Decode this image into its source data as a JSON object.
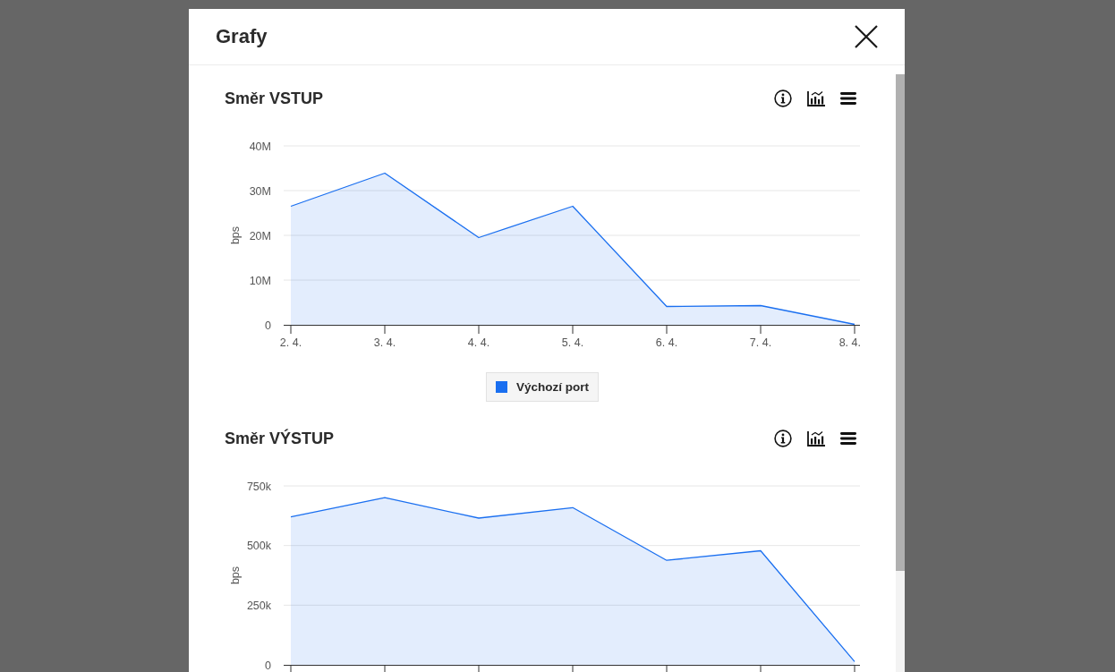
{
  "modal": {
    "title": "Grafy"
  },
  "charts": [
    {
      "title": "Směr VSTUP",
      "chart_data": {
        "type": "area",
        "grid": true,
        "ylabel": "bps",
        "categories": [
          "2. 4.",
          "3. 4.",
          "4. 4.",
          "5. 4.",
          "6. 4.",
          "7. 4.",
          "8. 4."
        ],
        "series": [
          {
            "name": "Výchozí port",
            "color": "#1a6ff0",
            "values": [
              26500000,
              33900000,
              19500000,
              26500000,
              4100000,
              4300000,
              100000
            ]
          }
        ],
        "ylim": [
          0,
          40000000
        ],
        "yticks": [
          {
            "value": 0,
            "label": "0"
          },
          {
            "value": 10000000,
            "label": "10M"
          },
          {
            "value": 20000000,
            "label": "20M"
          },
          {
            "value": 30000000,
            "label": "30M"
          },
          {
            "value": 40000000,
            "label": "40M"
          }
        ]
      }
    },
    {
      "title": "Směr VÝSTUP",
      "chart_data": {
        "type": "area",
        "grid": true,
        "ylabel": "bps",
        "series": [
          {
            "color": "#1a6ff0",
            "values": [
              620000,
              701000,
              615000,
              659000,
              438000,
              478000,
              14000
            ]
          }
        ],
        "ylim": [
          0,
          750000
        ],
        "yticks": [
          {
            "value": 0,
            "label": "0"
          },
          {
            "value": 250000,
            "label": "250k"
          },
          {
            "value": 500000,
            "label": "500k"
          },
          {
            "value": 750000,
            "label": "750k"
          }
        ]
      }
    }
  ]
}
